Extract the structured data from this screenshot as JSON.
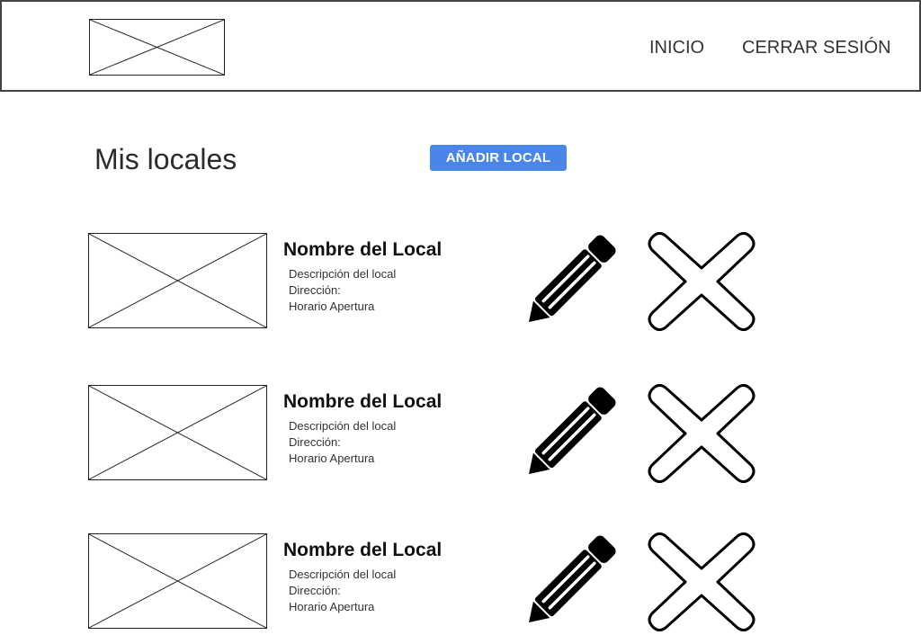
{
  "header": {
    "nav": {
      "inicio": "INICIO",
      "logout": "CERRAR SESIÓN"
    }
  },
  "main": {
    "title": "Mis locales",
    "add_button_label": "AÑADIR LOCAL",
    "locals": [
      {
        "name": "Nombre del Local",
        "description": "Descripción del local",
        "address": "Dirección:",
        "hours": "Horario Apertura"
      },
      {
        "name": "Nombre del Local",
        "description": "Descripción del local",
        "address": "Dirección:",
        "hours": "Horario Apertura"
      },
      {
        "name": "Nombre del Local",
        "description": "Descripción del local",
        "address": "Dirección:",
        "hours": "Horario Apertura"
      }
    ]
  },
  "icons": {
    "logo": "image-placeholder-icon",
    "thumbnail": "image-placeholder-icon",
    "edit": "pencil-icon",
    "delete": "close-icon"
  },
  "colors": {
    "accent": "#4a86e8",
    "border": "#444444",
    "text": "#222222"
  }
}
